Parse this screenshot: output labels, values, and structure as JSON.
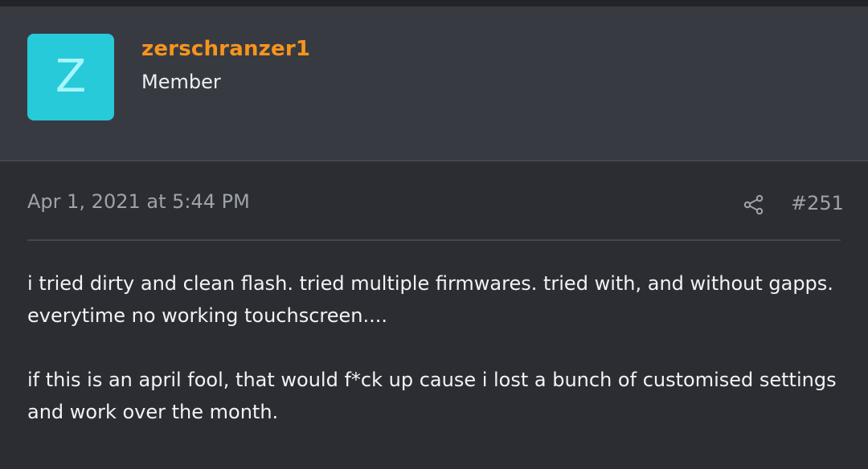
{
  "user": {
    "avatar_letter": "Z",
    "avatar_color": "#27cad8",
    "username": "zerschranzer1",
    "username_color": "#f7941d",
    "role": "Member"
  },
  "post": {
    "date": "Apr 1, 2021 at 5:44 PM",
    "share_icon": "share-icon",
    "number": "#251",
    "paragraphs": [
      "i tried dirty and clean flash. tried multiple firmwares. tried with, and without gapps. everytime no working touchscreen....",
      "if this is an april fool, that would f*ck up cause i lost a bunch of customised settings and work over the month."
    ]
  }
}
